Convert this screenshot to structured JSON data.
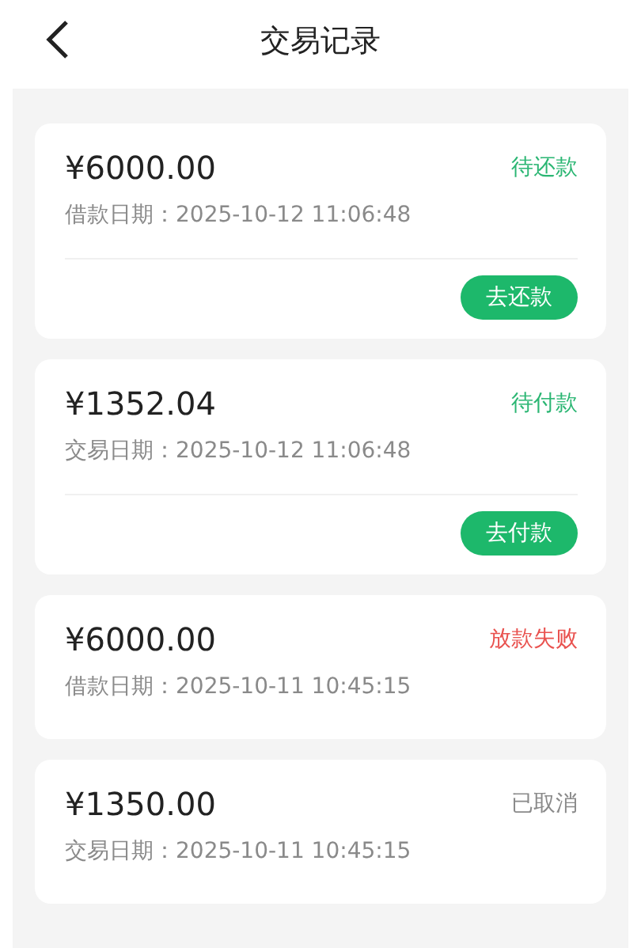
{
  "header": {
    "title": "交易记录"
  },
  "records": [
    {
      "amount": "¥6000.00",
      "status": "待还款",
      "color": "#2bb673",
      "date_label": "借款日期：",
      "date": "2025-10-12 11:06:48",
      "action": "去还款"
    },
    {
      "amount": "¥1352.04",
      "status": "待付款",
      "color": "#2bb673",
      "date_label": "交易日期：",
      "date": "2025-10-12 11:06:48",
      "action": "去付款"
    },
    {
      "amount": "¥6000.00",
      "status": "放款失败",
      "color": "#e9524f",
      "date_label": "借款日期：",
      "date": "2025-10-11 10:45:15"
    },
    {
      "amount": "¥1350.00",
      "status": "已取消",
      "color": "#8a8a8a",
      "date_label": "交易日期：",
      "date": "2025-10-11 10:45:15"
    }
  ]
}
